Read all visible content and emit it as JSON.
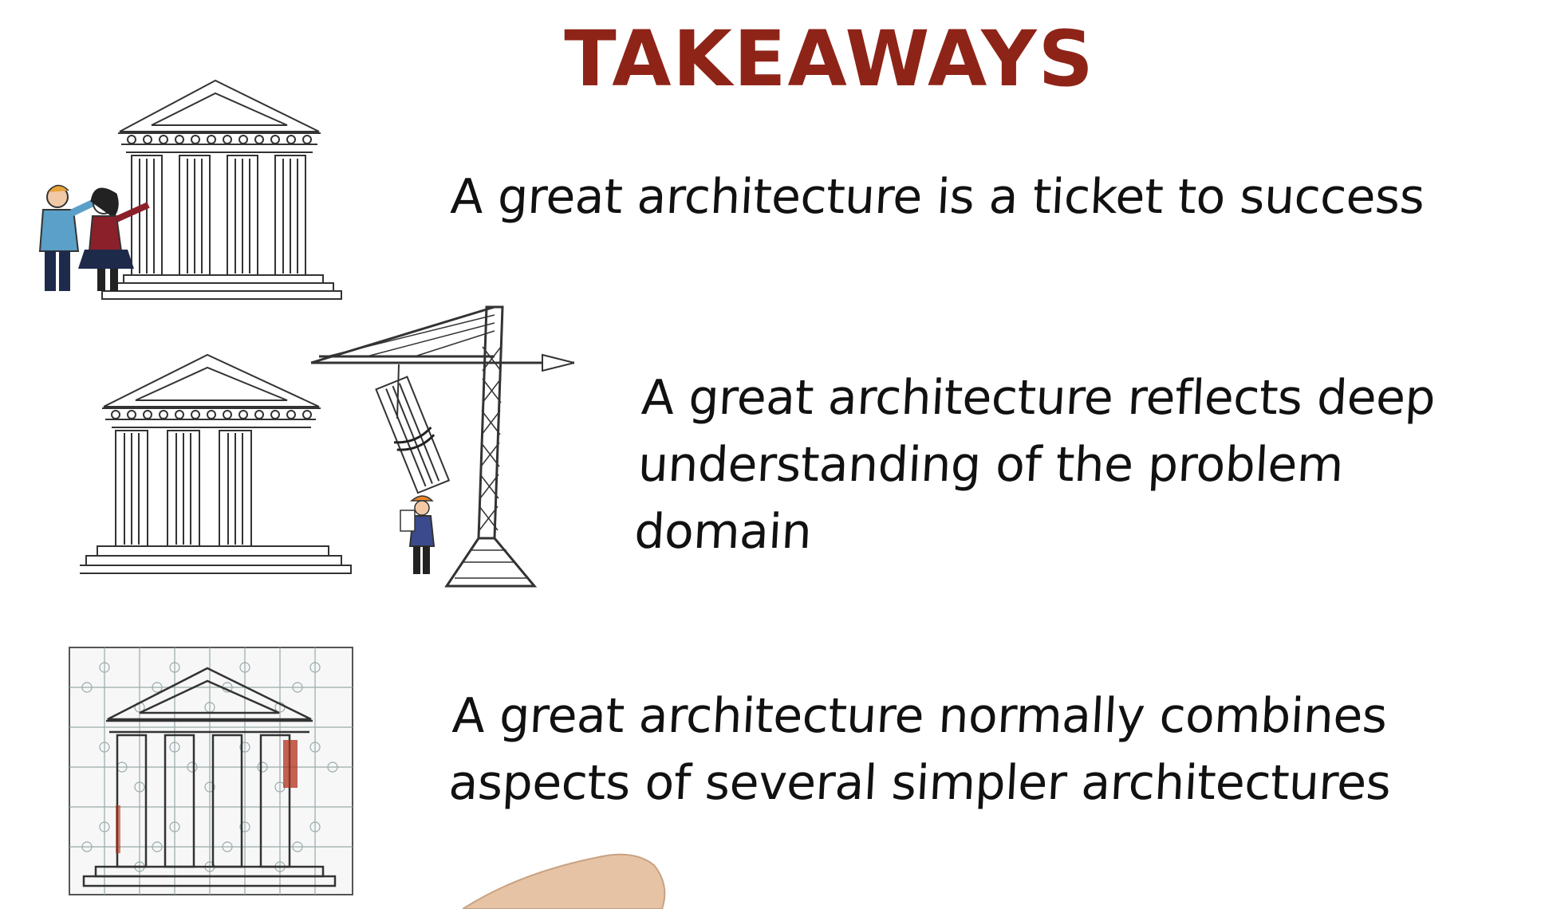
{
  "heading": "TAKEAWAYS",
  "takeaways": [
    {
      "lines": [
        "A great architecture is a ticket to success"
      ]
    },
    {
      "lines": [
        "A great architecture reflects deep",
        "understanding of the problem domain"
      ]
    },
    {
      "lines": [
        "A great architecture normally combines",
        "aspects of several simpler architectures"
      ]
    }
  ],
  "colors": {
    "heading": "#8e2418",
    "ink": "#111111",
    "accent_red": "#b0301c"
  },
  "illustrations": [
    "temple-with-two-people",
    "temple-under-construction-with-crane",
    "temple-jigsaw-puzzle"
  ]
}
